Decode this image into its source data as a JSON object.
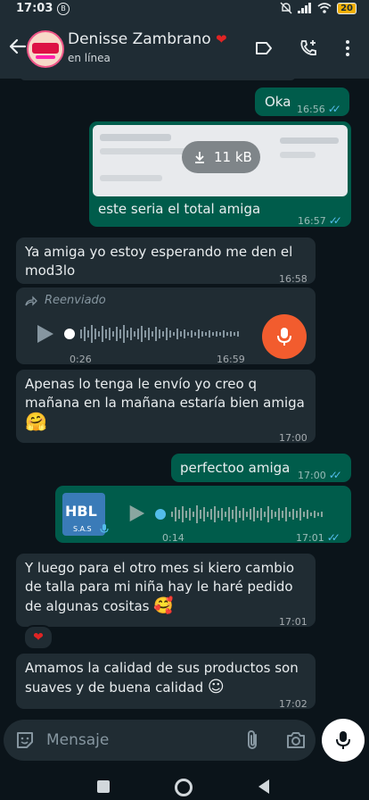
{
  "status": {
    "time": "17:03",
    "badge": "B",
    "battery": "20"
  },
  "header": {
    "name": "Denisse Zambrano",
    "heart": "❤",
    "status": "en línea"
  },
  "messages": [
    {
      "text": "Oka",
      "time": "16:56"
    },
    {
      "file_size": "11 kB",
      "caption": "este seria el total amiga",
      "time": "16:57"
    },
    {
      "text": "Ya amiga yo estoy esperando me den el mod3lo",
      "time": "16:58"
    },
    {
      "forwarded": "Reenviado",
      "duration": "0:26",
      "time": "16:59"
    },
    {
      "text": "Apenas lo tenga le envío yo creo q mañana en la mañana estaría bien amiga",
      "emoji": "🤗",
      "time": "17:00"
    },
    {
      "text": "perfectoo amiga",
      "time": "17:00"
    },
    {
      "avatar_text": "HBL",
      "avatar_sub": "S.A.S",
      "duration": "0:14",
      "time": "17:01"
    },
    {
      "text": "Y luego para el otro mes si kiero cambio de talla para mi niña hay le haré pedido de algunas cositas",
      "emoji": "🥰",
      "time": "17:01",
      "reaction": "❤"
    },
    {
      "text": "Amamos la calidad de sus productos son suaves y de buena calidad",
      "emoji": "☺",
      "time": "17:02"
    }
  ],
  "composer": {
    "placeholder": "Mensaje"
  },
  "colors": {
    "outgoing": "#005c4b",
    "incoming": "#202c33",
    "accent_mic": "#f25c2e",
    "ticks": "#53bdeb"
  }
}
